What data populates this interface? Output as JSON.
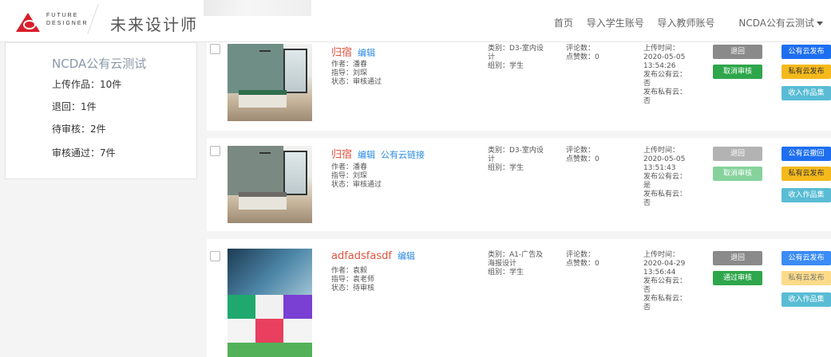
{
  "header": {
    "logo_line1": "FUTURE",
    "logo_line2": "DESIGNER",
    "site_name": "未来设计师",
    "nav": [
      "首页",
      "导入学生账号",
      "导入教师账号",
      "NCDA公有云测试"
    ]
  },
  "sidebar": {
    "title": "NCDA公有云测试",
    "stats": [
      "上传作品：10件",
      "退回：1件",
      "待审核：2件",
      "审核通过：7件"
    ]
  },
  "works": [
    {
      "title": "归宿",
      "links": [
        "编辑"
      ],
      "author": "作者：潘春",
      "mentor": "指导：刘琛",
      "status": "状态：审核通过",
      "category": [
        "类别：D3-室内设",
        "计"
      ],
      "group": "组别：学生",
      "comments": "评论数：",
      "likes": "点赞数：0",
      "upload": [
        "上传时间：",
        "2020-05-05",
        "13:54:26",
        "发布公有云：",
        "否",
        "发布私有云：",
        "否"
      ],
      "btn_left": [
        "退回",
        "取消审核"
      ],
      "btn_right": [
        "公有云发布",
        "私有云发布",
        "收入作品集"
      ]
    },
    {
      "title": "归宿",
      "links": [
        "编辑",
        "公有云链接"
      ],
      "author": "作者：潘春",
      "mentor": "指导：刘琛",
      "status": "状态：审核通过",
      "category": [
        "类别：D3-室内设",
        "计"
      ],
      "group": "组别：学生",
      "comments": "评论数：",
      "likes": "点赞数：0",
      "upload": [
        "上传时间：",
        "2020-05-05",
        "13:51:43",
        "发布公有云：",
        "是",
        "发布私有云：",
        "否"
      ],
      "btn_left": [
        "退回",
        "取消审核"
      ],
      "btn_right": [
        "公有云撤回",
        "私有云发布",
        "收入作品集"
      ]
    },
    {
      "title": "adfadsfasdf",
      "links": [
        "编辑"
      ],
      "author": "作者：袁毅",
      "mentor": "指导：袁老师",
      "status": "状态：待审核",
      "category": [
        "类别：A1-广告及",
        "海报设计"
      ],
      "group": "组别：学生",
      "comments": "评论数：",
      "likes": "点赞数：0",
      "upload": [
        "上传时间：",
        "2020-04-29",
        "13:56:44",
        "发布公有云：",
        "否",
        "发布私有云：",
        "否"
      ],
      "btn_left": [
        "退回",
        "通过审核"
      ],
      "btn_right": [
        "公有云发布",
        "私有云发布",
        "收入作品集"
      ]
    }
  ],
  "colors": {
    "accent_red": "#e0533f",
    "link_blue": "#2a8be2",
    "btn_blue": "#1e6ff0",
    "btn_green": "#2ea64b",
    "btn_yellow": "#f4b91c",
    "btn_cyan": "#59bcd4",
    "btn_gray": "#8a8a8a"
  }
}
